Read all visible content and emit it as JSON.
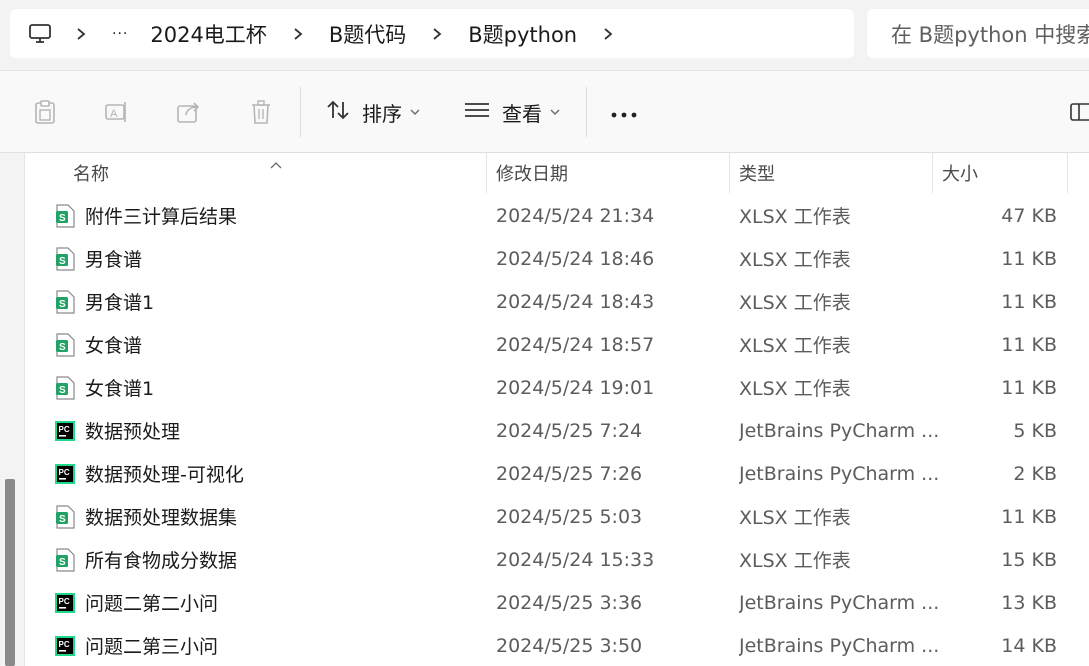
{
  "address_bar": {
    "breadcrumbs": [
      "2024电工杯",
      "B题代码",
      "B题python"
    ],
    "overflow_label": "···",
    "search_placeholder": "在 B题python 中搜索"
  },
  "toolbar": {
    "icons": [
      "paste-icon",
      "rename-icon",
      "share-icon",
      "delete-icon"
    ],
    "sort_label": "排序",
    "view_label": "查看",
    "more_label": "···"
  },
  "columns": {
    "name": "名称",
    "date": "修改日期",
    "type": "类型",
    "size": "大小"
  },
  "files": [
    {
      "name": "附件三计算后结果",
      "date": "2024/5/24 21:34",
      "type": "XLSX 工作表",
      "size": "47 KB",
      "icon": "xlsx-icon"
    },
    {
      "name": "男食谱",
      "date": "2024/5/24 18:46",
      "type": "XLSX 工作表",
      "size": "11 KB",
      "icon": "xlsx-icon"
    },
    {
      "name": "男食谱1",
      "date": "2024/5/24 18:43",
      "type": "XLSX 工作表",
      "size": "11 KB",
      "icon": "xlsx-icon"
    },
    {
      "name": "女食谱",
      "date": "2024/5/24 18:57",
      "type": "XLSX 工作表",
      "size": "11 KB",
      "icon": "xlsx-icon"
    },
    {
      "name": "女食谱1",
      "date": "2024/5/24 19:01",
      "type": "XLSX 工作表",
      "size": "11 KB",
      "icon": "xlsx-icon"
    },
    {
      "name": "数据预处理",
      "date": "2024/5/25 7:24",
      "type": "JetBrains PyCharm ...",
      "size": "5 KB",
      "icon": "pycharm-icon"
    },
    {
      "name": "数据预处理-可视化",
      "date": "2024/5/25 7:26",
      "type": "JetBrains PyCharm ...",
      "size": "2 KB",
      "icon": "pycharm-icon"
    },
    {
      "name": "数据预处理数据集",
      "date": "2024/5/25 5:03",
      "type": "XLSX 工作表",
      "size": "11 KB",
      "icon": "xlsx-icon"
    },
    {
      "name": "所有食物成分数据",
      "date": "2024/5/24 15:33",
      "type": "XLSX 工作表",
      "size": "15 KB",
      "icon": "xlsx-icon"
    },
    {
      "name": "问题二第二小问",
      "date": "2024/5/25 3:36",
      "type": "JetBrains PyCharm ...",
      "size": "13 KB",
      "icon": "pycharm-icon"
    },
    {
      "name": "问题二第三小问",
      "date": "2024/5/25 3:50",
      "type": "JetBrains PyCharm ...",
      "size": "14 KB",
      "icon": "pycharm-icon"
    }
  ],
  "colors": {
    "xlsx_icon": "#21a366",
    "pycharm_icon_bg": "#000000",
    "pycharm_icon_accent": "#21d789"
  }
}
